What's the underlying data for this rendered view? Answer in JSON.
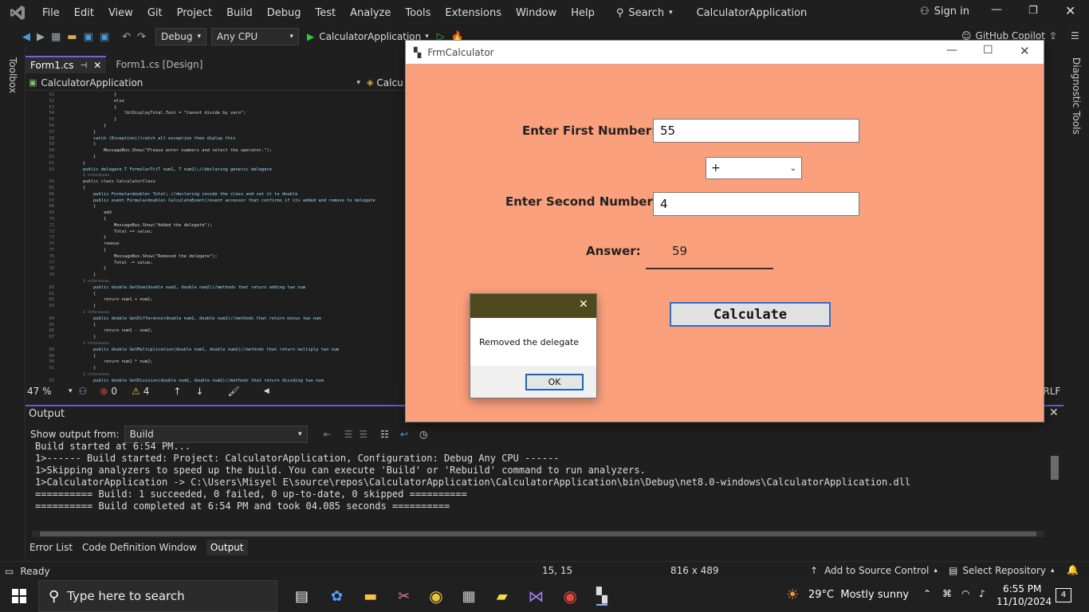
{
  "menu": [
    "File",
    "Edit",
    "View",
    "Git",
    "Project",
    "Build",
    "Debug",
    "Test",
    "Analyze",
    "Tools",
    "Extensions",
    "Window",
    "Help"
  ],
  "search_label": "Search",
  "solution_title": "CalculatorApplication",
  "sign_in": "Sign in",
  "toolbar": {
    "config": "Debug",
    "platform": "Any CPU",
    "run_target": "CalculatorApplication",
    "copilot": "GitHub Copilot"
  },
  "left_tool": "Toolbox",
  "right_tool": "Diagnostic Tools",
  "tabs": [
    {
      "label": "Form1.cs"
    },
    {
      "label": "Form1.cs [Design]"
    }
  ],
  "navbar": {
    "project": "CalculatorApplication",
    "partial": "Calcu"
  },
  "code_lines": [
    {
      "n": "51",
      "t": "            }"
    },
    {
      "n": "52",
      "t": "            else"
    },
    {
      "n": "53",
      "t": "            {"
    },
    {
      "n": "54",
      "t": "                lblDisplayTotal.Text = \"Cannot divide by zero\";"
    },
    {
      "n": "55",
      "t": "            }"
    },
    {
      "n": "56",
      "t": "        }"
    },
    {
      "n": "57",
      "t": "    }"
    },
    {
      "n": "58",
      "t": "    catch (Exception)//catch all exception then diplay this"
    },
    {
      "n": "59",
      "t": "    {"
    },
    {
      "n": "60",
      "t": "        MessageBox.Show(\"Please enter numbers and select the operator.\");"
    },
    {
      "n": "61",
      "t": "    }"
    },
    {
      "n": "62",
      "t": "}"
    },
    {
      "n": "63",
      "t": "public delegate T Formula<T>(T num1, T num2);//declaring generic delegate"
    },
    {
      "n": "",
      "t": "3 references"
    },
    {
      "n": "64",
      "t": "public class CalculatorClass"
    },
    {
      "n": "65",
      "t": "{"
    },
    {
      "n": "66",
      "t": "    public Formula<double> Total; //declaring inside the class and set it to double"
    },
    {
      "n": "67",
      "t": "    public event Formula<double> CalculateEvent//event accessor that confirms if its added and remove to delegate"
    },
    {
      "n": "68",
      "t": "    {"
    },
    {
      "n": "69",
      "t": "        add"
    },
    {
      "n": "70",
      "t": "        {"
    },
    {
      "n": "71",
      "t": "            MessageBox.Show(\"Added the delegate\");"
    },
    {
      "n": "72",
      "t": "            Total += value;"
    },
    {
      "n": "73",
      "t": "        }"
    },
    {
      "n": "74",
      "t": "        remove"
    },
    {
      "n": "75",
      "t": "        {"
    },
    {
      "n": "76",
      "t": "            MessageBox.Show(\"Removed the delegate\");"
    },
    {
      "n": "77",
      "t": "            Total -= value;"
    },
    {
      "n": "78",
      "t": "        }"
    },
    {
      "n": "79",
      "t": "    }"
    },
    {
      "n": "",
      "t": "3 references"
    },
    {
      "n": "80",
      "t": "    public double GetSum(double num1, double num2)//methods that return adding two num"
    },
    {
      "n": "81",
      "t": "    {"
    },
    {
      "n": "82",
      "t": "        return num1 + num2;"
    },
    {
      "n": "83",
      "t": "    }"
    },
    {
      "n": "",
      "t": "3 references"
    },
    {
      "n": "84",
      "t": "    public double GetDifference(double num1, double num2)//methods that return minus two num"
    },
    {
      "n": "85",
      "t": "    {"
    },
    {
      "n": "86",
      "t": "        return num1 - num2;"
    },
    {
      "n": "87",
      "t": "    }"
    },
    {
      "n": "",
      "t": "3 references"
    },
    {
      "n": "88",
      "t": "    public double GetMultiplication(double num1, double num2)//methods that return multiply two num"
    },
    {
      "n": "89",
      "t": "    {"
    },
    {
      "n": "90",
      "t": "        return num1 * num2;"
    },
    {
      "n": "91",
      "t": "    }"
    },
    {
      "n": "",
      "t": "3 references"
    },
    {
      "n": "92",
      "t": "    public double GetDivision(double num1, double num2)//methods that return dividing two num"
    },
    {
      "n": "93",
      "t": "    {"
    }
  ],
  "editor_status": {
    "zoom": "47 %",
    "errors": "0",
    "warnings": "4",
    "eol": "CRLF"
  },
  "output": {
    "title": "Output",
    "show_from_label": "Show output from:",
    "source": "Build",
    "lines": [
      "Build started at 6:54 PM...",
      "1>------ Build started: Project: CalculatorApplication, Configuration: Debug Any CPU ------",
      "1>Skipping analyzers to speed up the build. You can execute 'Build' or 'Rebuild' command to run analyzers.",
      "1>CalculatorApplication -> C:\\Users\\Misyel E\\source\\repos\\CalculatorApplication\\CalculatorApplication\\bin\\Debug\\net8.0-windows\\CalculatorApplication.dll",
      "========== Build: 1 succeeded, 0 failed, 0 up-to-date, 0 skipped ==========",
      "========== Build completed at 6:54 PM and took 04.085 seconds =========="
    ]
  },
  "bottom_tabs": [
    "Error List",
    "Code Definition Window",
    "Output"
  ],
  "status": {
    "ready": "Ready",
    "position": "15, 15",
    "size": "816 x 489",
    "source_control": "Add to Source Control",
    "repository": "Select Repository"
  },
  "form": {
    "title": "FrmCalculator",
    "first_label": "Enter First Number:",
    "first_value": "55",
    "operator": "+",
    "second_label": "Enter Second Number:",
    "second_value": "4",
    "answer_label": "Answer:",
    "answer_value": "59",
    "calculate": "Calculate"
  },
  "dialog": {
    "message": "Removed the delegate",
    "ok": "OK"
  },
  "taskbar": {
    "search_placeholder": "Type here to search",
    "weather": "29°C  Mostly sunny",
    "time": "6:55 PM",
    "date": "11/10/2024",
    "notifications": "4"
  }
}
